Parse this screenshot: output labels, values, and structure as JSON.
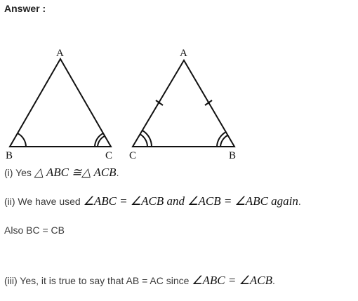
{
  "answer": {
    "heading": "Answer :"
  },
  "figure": {
    "left_triangle": {
      "apex": "A",
      "base_left": "B",
      "base_right": "C"
    },
    "right_triangle": {
      "apex": "A",
      "base_left": "C",
      "base_right": "B"
    }
  },
  "parts": {
    "i": {
      "text": "(i) Yes ",
      "math": "△ ABC ≅△ ACB",
      "end": "."
    },
    "ii": {
      "text": "(ii) We have used ",
      "math": "∠ABC = ∠ACB and ∠ACB = ∠ABC again",
      "end": "."
    },
    "also": {
      "text": "Also BC = CB"
    },
    "iii": {
      "text": "(iii) Yes, it is true to say that AB = AC since ",
      "math": "∠ABC = ∠ACB",
      "end": "."
    }
  }
}
